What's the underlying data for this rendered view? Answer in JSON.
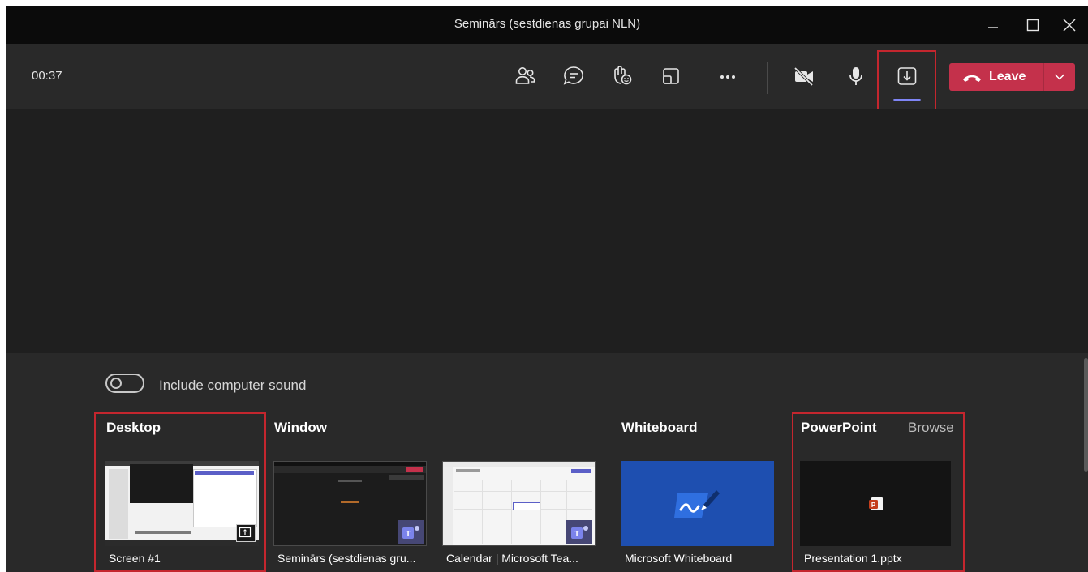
{
  "window": {
    "title": "Seminārs (sestdienas grupai NLN)",
    "controls": [
      "minimize",
      "maximize",
      "close"
    ]
  },
  "toolbar": {
    "timer": "00:37",
    "buttons": [
      {
        "name": "participants",
        "icon": "people-icon"
      },
      {
        "name": "chat",
        "icon": "chat-icon"
      },
      {
        "name": "raise-hand",
        "icon": "raise-hand-icon"
      },
      {
        "name": "rooms",
        "icon": "rooms-icon"
      },
      {
        "name": "more-actions",
        "icon": "more-icon"
      },
      {
        "name": "camera",
        "icon": "camera-off-icon"
      },
      {
        "name": "microphone",
        "icon": "microphone-icon"
      },
      {
        "name": "share",
        "icon": "share-tray-icon",
        "active": true
      }
    ],
    "leave": {
      "label": "Leave",
      "color": "#c4314b"
    }
  },
  "share_tray": {
    "sound_toggle": {
      "label": "Include computer sound",
      "on": false
    },
    "sections": {
      "desktop": {
        "heading": "Desktop",
        "items": [
          {
            "caption": "Screen #1"
          }
        ]
      },
      "window": {
        "heading": "Window",
        "items": [
          {
            "caption": "Seminārs (sestdienas gru..."
          },
          {
            "caption": "Calendar | Microsoft Tea..."
          }
        ]
      },
      "whiteboard": {
        "heading": "Whiteboard",
        "items": [
          {
            "caption": "Microsoft Whiteboard"
          }
        ]
      },
      "powerpoint": {
        "heading": "PowerPoint",
        "browse_label": "Browse",
        "items": [
          {
            "caption": "Presentation 1.pptx"
          }
        ]
      }
    }
  },
  "colors": {
    "highlight": "#c4262e",
    "accent": "#7f85f5",
    "leave": "#c4314b",
    "whiteboard_tile": "#1e4fb0"
  }
}
